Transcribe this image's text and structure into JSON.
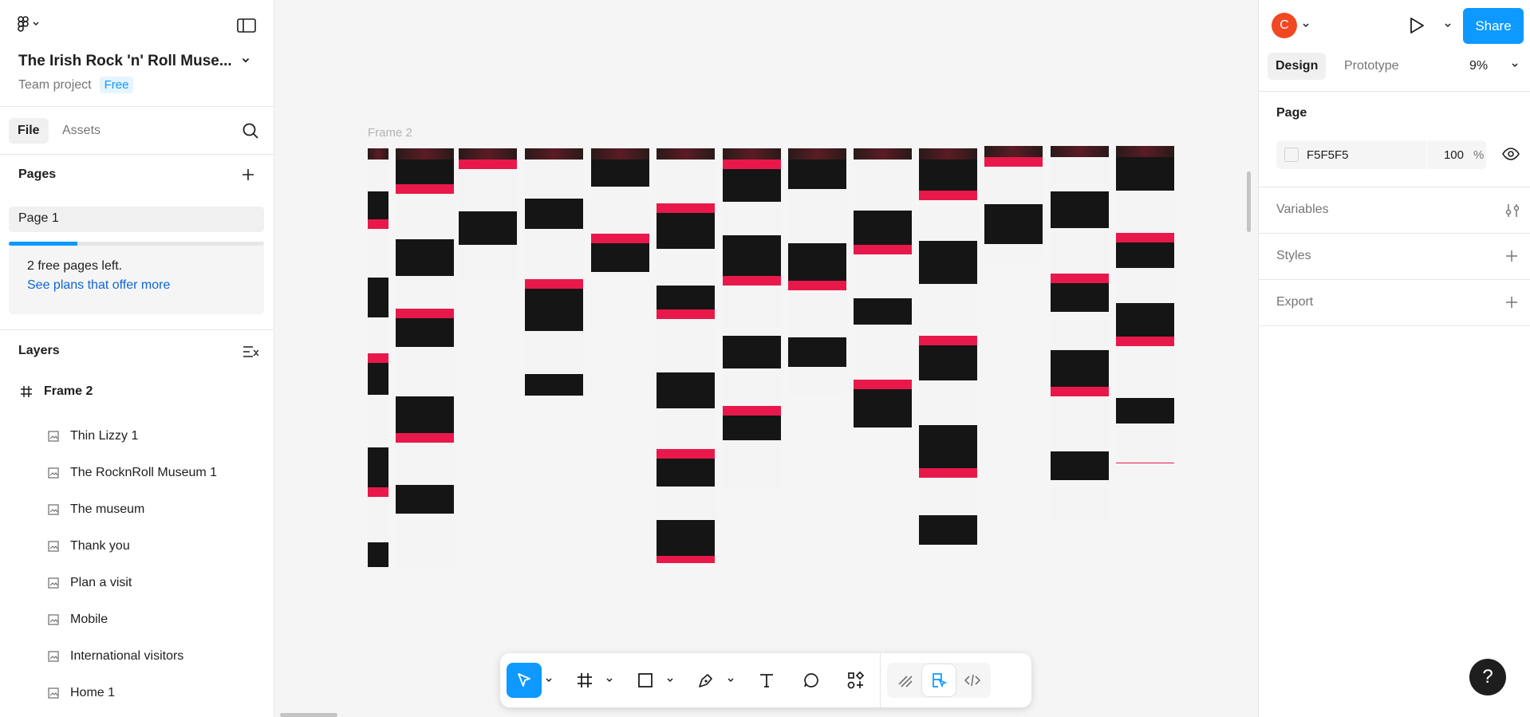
{
  "left_panel": {
    "project_title": "The Irish Rock 'n' Roll Muse...",
    "project_team": "Team project",
    "project_plan": "Free",
    "tabs": {
      "file": "File",
      "assets": "Assets"
    },
    "pages_heading": "Pages",
    "pages": [
      "Page 1"
    ],
    "pages_progress": 0.27,
    "free_pages_text": "2 free pages left.",
    "see_plans_link": "See plans that offer more",
    "layers_heading": "Layers",
    "frame_layer": "Frame 2",
    "layers": [
      "Thin Lizzy 1",
      "The RocknRoll Museum 1",
      "The museum",
      "Thank you",
      "Plan a visit",
      "Mobile",
      "International visitors",
      "Home 1"
    ]
  },
  "canvas": {
    "frame_label": "Frame 2",
    "accent_red": "#e8194a"
  },
  "toolbar": {
    "tools": [
      "move-tool",
      "frame-tool",
      "shape-tool",
      "pen-tool",
      "text-tool",
      "comment-tool",
      "actions-tool"
    ],
    "modes": [
      "draw-mode",
      "design-mode",
      "dev-mode"
    ]
  },
  "right_panel": {
    "avatar_initial": "C",
    "share_label": "Share",
    "tabs": {
      "design": "Design",
      "prototype": "Prototype"
    },
    "zoom": "9%",
    "page_heading": "Page",
    "page_fill_hex": "F5F5F5",
    "page_fill_opacity": "100",
    "percent_sign": "%",
    "variables_label": "Variables",
    "styles_label": "Styles",
    "export_label": "Export"
  },
  "help_label": "?",
  "colors": {
    "brand_blue": "#0d99ff",
    "avatar_orange": "#f24822"
  }
}
